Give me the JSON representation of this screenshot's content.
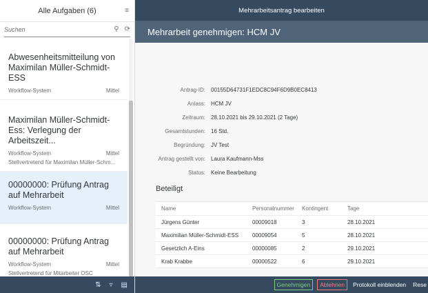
{
  "master": {
    "title": "Alle Aufgaben (6)",
    "search_placeholder": "Suchen",
    "items": [
      {
        "title": "Abwesenheitsmitteilung von Maximilan Müller-Schmidt-ESS",
        "creator": "Workflow-System",
        "priority": "Mittel",
        "substitute": ""
      },
      {
        "title": "Maximilan Müller-Schmidt-Ess: Verlegung der Arbeitszeit...",
        "creator": "Workflow-System",
        "priority": "Mittel",
        "substitute": "Stellvertretend für Maximilan Müller-Schm..."
      },
      {
        "title": "00000000: Prüfung Antrag auf Mehrarbeit",
        "creator": "Workflow-System",
        "priority": "Mittel",
        "substitute": ""
      },
      {
        "title": "00000000: Prüfung Antrag auf Mehrarbeit",
        "creator": "Workflow-System",
        "priority": "Mittel",
        "substitute": "Stellvertretend für Mitarbeiter OSC"
      }
    ]
  },
  "detail": {
    "shell_title": "Mehrarbeitsantrag bearbeiten",
    "header_title": "Mehrarbeit genehmigen: HCM JV",
    "fields": [
      {
        "label": "Antrag-ID:",
        "value": "00155D64731F1EDC8C94F6D9B0EC8413"
      },
      {
        "label": "Anlass:",
        "value": "HCM JV"
      },
      {
        "label": "Zeitraum:",
        "value": "28.10.2021 bis 29.10.2021 (2 Tage)"
      },
      {
        "label": "Gesamtstunden:",
        "value": "16 Std."
      },
      {
        "label": "Begründung:",
        "value": "JV Test"
      },
      {
        "label": "Antrag gestellt von:",
        "value": "Laura Kaufmann-Mss"
      },
      {
        "label": "Status:",
        "value": "Keine Bearbeitung"
      }
    ],
    "section_title": "Beteiligt",
    "table": {
      "headers": [
        "Name",
        "Personalnummer",
        "Kontingent",
        "Tage"
      ],
      "rows": [
        [
          "Jürgens Günter",
          "00009018",
          "3",
          "28.10.2021"
        ],
        [
          "Maximilian Müller-Schmidt-ESS",
          "00009054",
          "5",
          "28.10.2021"
        ],
        [
          "Gesetzlich A-Eins",
          "00000085",
          "2",
          "29.10.2021"
        ],
        [
          "Krab Krabbe",
          "00000522",
          "6",
          "29.10.2021"
        ]
      ]
    },
    "footer": {
      "approve": "Genehmigen",
      "reject": "Ablehnen",
      "show_log": "Protokoll einblenden",
      "more": "Rese"
    }
  }
}
